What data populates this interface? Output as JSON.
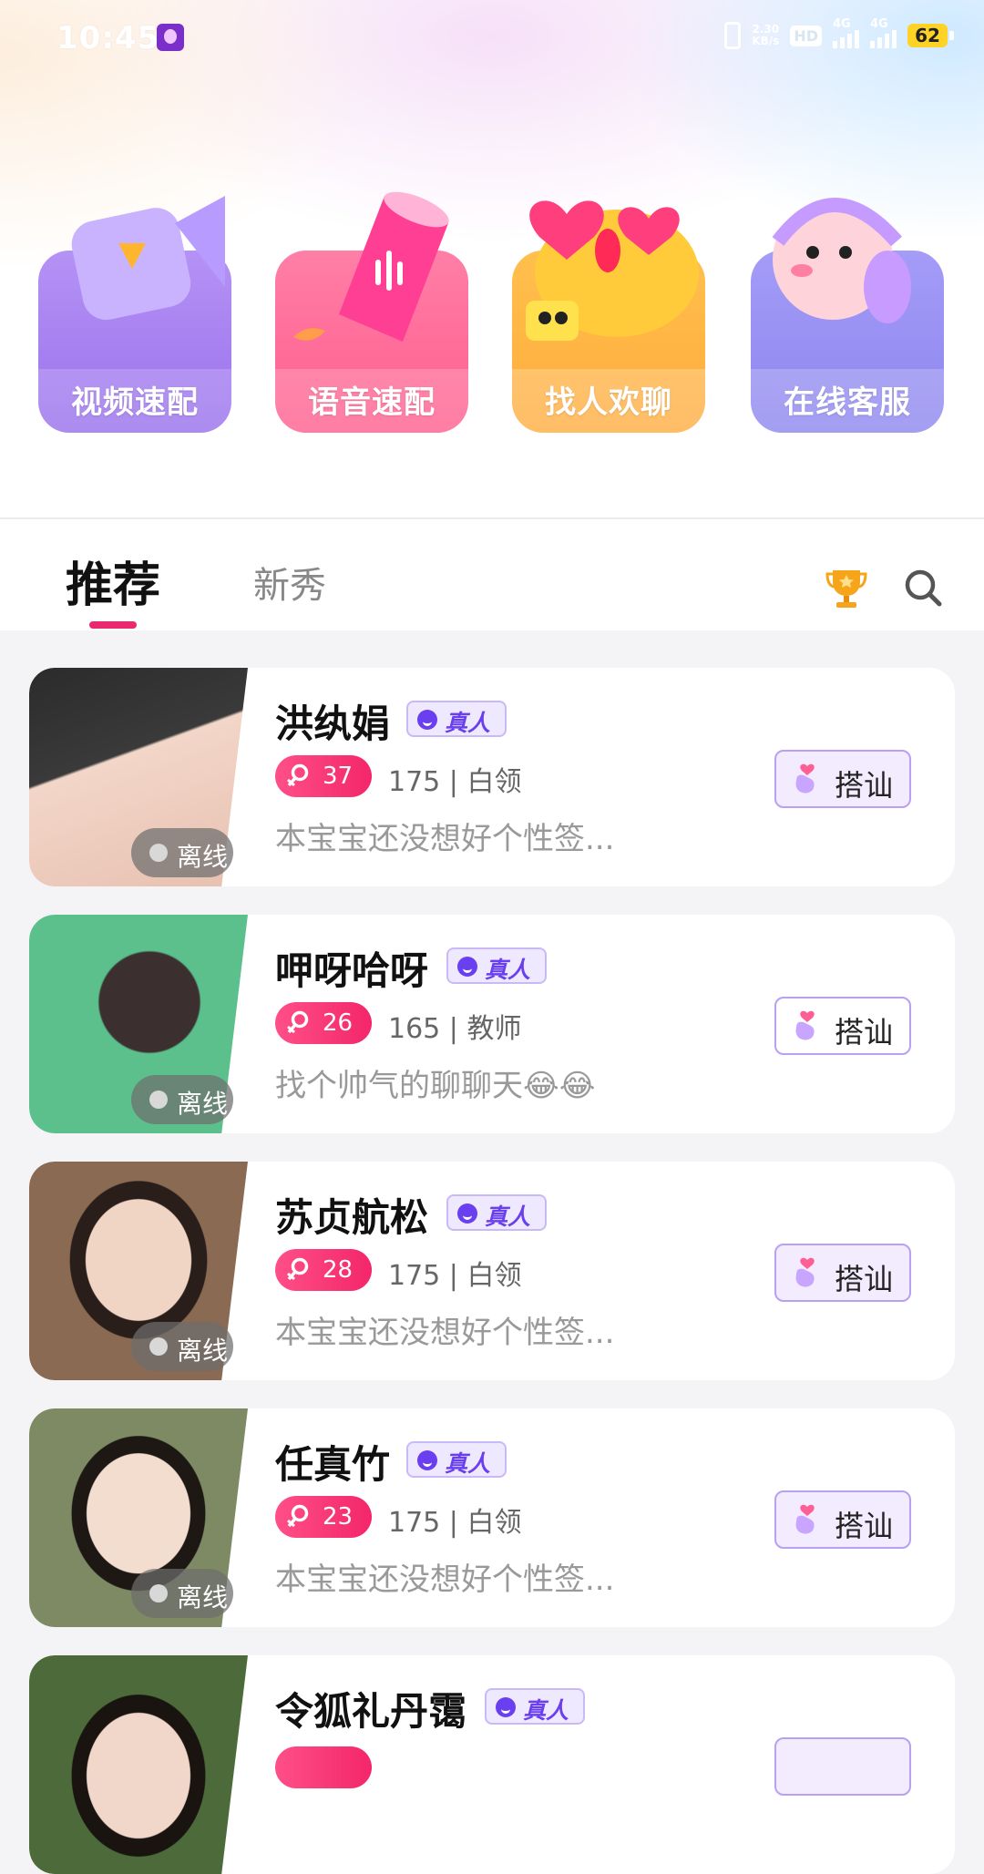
{
  "status_bar": {
    "time": "10:45",
    "net_speed_value": "2.30",
    "net_speed_unit": "KB/s",
    "hd_label": "HD",
    "signal1_label": "4G",
    "signal2_label": "4G",
    "battery": "62"
  },
  "features": [
    {
      "label": "视频速配",
      "icon": "video-camera-icon"
    },
    {
      "label": "语音速配",
      "icon": "voice-cup-icon"
    },
    {
      "label": "找人欢聊",
      "icon": "hearts-chat-icon"
    },
    {
      "label": "在线客服",
      "icon": "headset-mascot-icon"
    }
  ],
  "tabs": {
    "recommend": "推荐",
    "new": "新秀"
  },
  "users": [
    {
      "name": "洪纨娟",
      "badge": "真人",
      "age": "37",
      "meta": "175 | 白领",
      "signature": "本宝宝还没想好个性签...",
      "status": "离线",
      "action": "搭讪",
      "avatar_colors": [
        "#2b2b2b",
        "#f2d6c8"
      ]
    },
    {
      "name": "呷呀哈呀",
      "badge": "真人",
      "age": "26",
      "meta": "165 | 教师",
      "signature": "找个帅气的聊聊天😂😂",
      "status": "离线",
      "action": "搭讪",
      "avatar_colors": [
        "#5cc08c",
        "#3b2f2f"
      ]
    },
    {
      "name": "苏贞航松",
      "badge": "真人",
      "age": "28",
      "meta": "175 | 白领",
      "signature": "本宝宝还没想好个性签...",
      "status": "离线",
      "action": "搭讪",
      "avatar_colors": [
        "#8a6a52",
        "#f0d4c4"
      ]
    },
    {
      "name": "任真竹",
      "badge": "真人",
      "age": "23",
      "meta": "175 | 白领",
      "signature": "本宝宝还没想好个性签...",
      "status": "离线",
      "action": "搭讪",
      "avatar_colors": [
        "#7d8a63",
        "#f3ddcf"
      ]
    },
    {
      "name": "令狐礼丹霭",
      "badge": "真人",
      "age": "",
      "meta": "",
      "signature": "",
      "status": "",
      "action": "",
      "avatar_colors": [
        "#4d6b3a",
        "#f1d7c9"
      ]
    }
  ],
  "colors": {
    "accent": "#ea2a6f",
    "badge_purple": "#6a3ff0"
  }
}
